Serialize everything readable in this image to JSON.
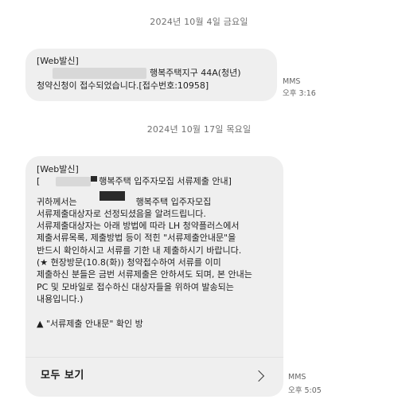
{
  "conversation": {
    "date_1": "2024년 10월 4일 금요일",
    "date_2": "2024년 10월 17일 목요일",
    "message_1": {
      "line_1": "[Web발신]",
      "line_2_suffix": "행복주택지구 44A(청년)",
      "line_3": "청약신청이 접수되었습니다.[접수번호:10958]",
      "type": "MMS",
      "time": "오후 3:16"
    },
    "message_2": {
      "line_1": "[Web발신]",
      "line_2_prefix": "[",
      "line_2_suffix": "행복주택 입주자모집 서류제출 안내]",
      "line_3_prefix": "귀하께서는",
      "line_3_suffix": "행복주택 입주자모집",
      "line_4": "서류제출대상자로 선정되셨음을 알려드립니다.",
      "line_5": "서류제출대상자는 아래 방법에 따라 LH 청약플러스에서",
      "line_6": "제출서류목록, 제출방법 등이 적힌 \"서류제출안내문\"을",
      "line_7": "반드시 확인하시고 서류를 기한 내 제출하시기 바랍니다.",
      "line_8": "(★ 현장방문(10.8(화)) 청약접수하여 서류를 이미",
      "line_9": "제출하신 분들은 금번 서류제출은 안하셔도 되며, 본 안내는",
      "line_10": "PC 및 모바일로 접수하신 대상자들을 위하여 발송되는",
      "line_11": "내용입니다.)",
      "line_12": "▲ \"서류제출 안내문\" 확인 방",
      "view_all_label": "모두 보기",
      "type": "MMS",
      "time": "오후 5:05"
    }
  },
  "colors": {
    "bubble": "#efefef",
    "meta_text": "#666666",
    "redaction": "#2a2a2a"
  },
  "icons": {
    "view_all": "chevron-right-icon"
  }
}
